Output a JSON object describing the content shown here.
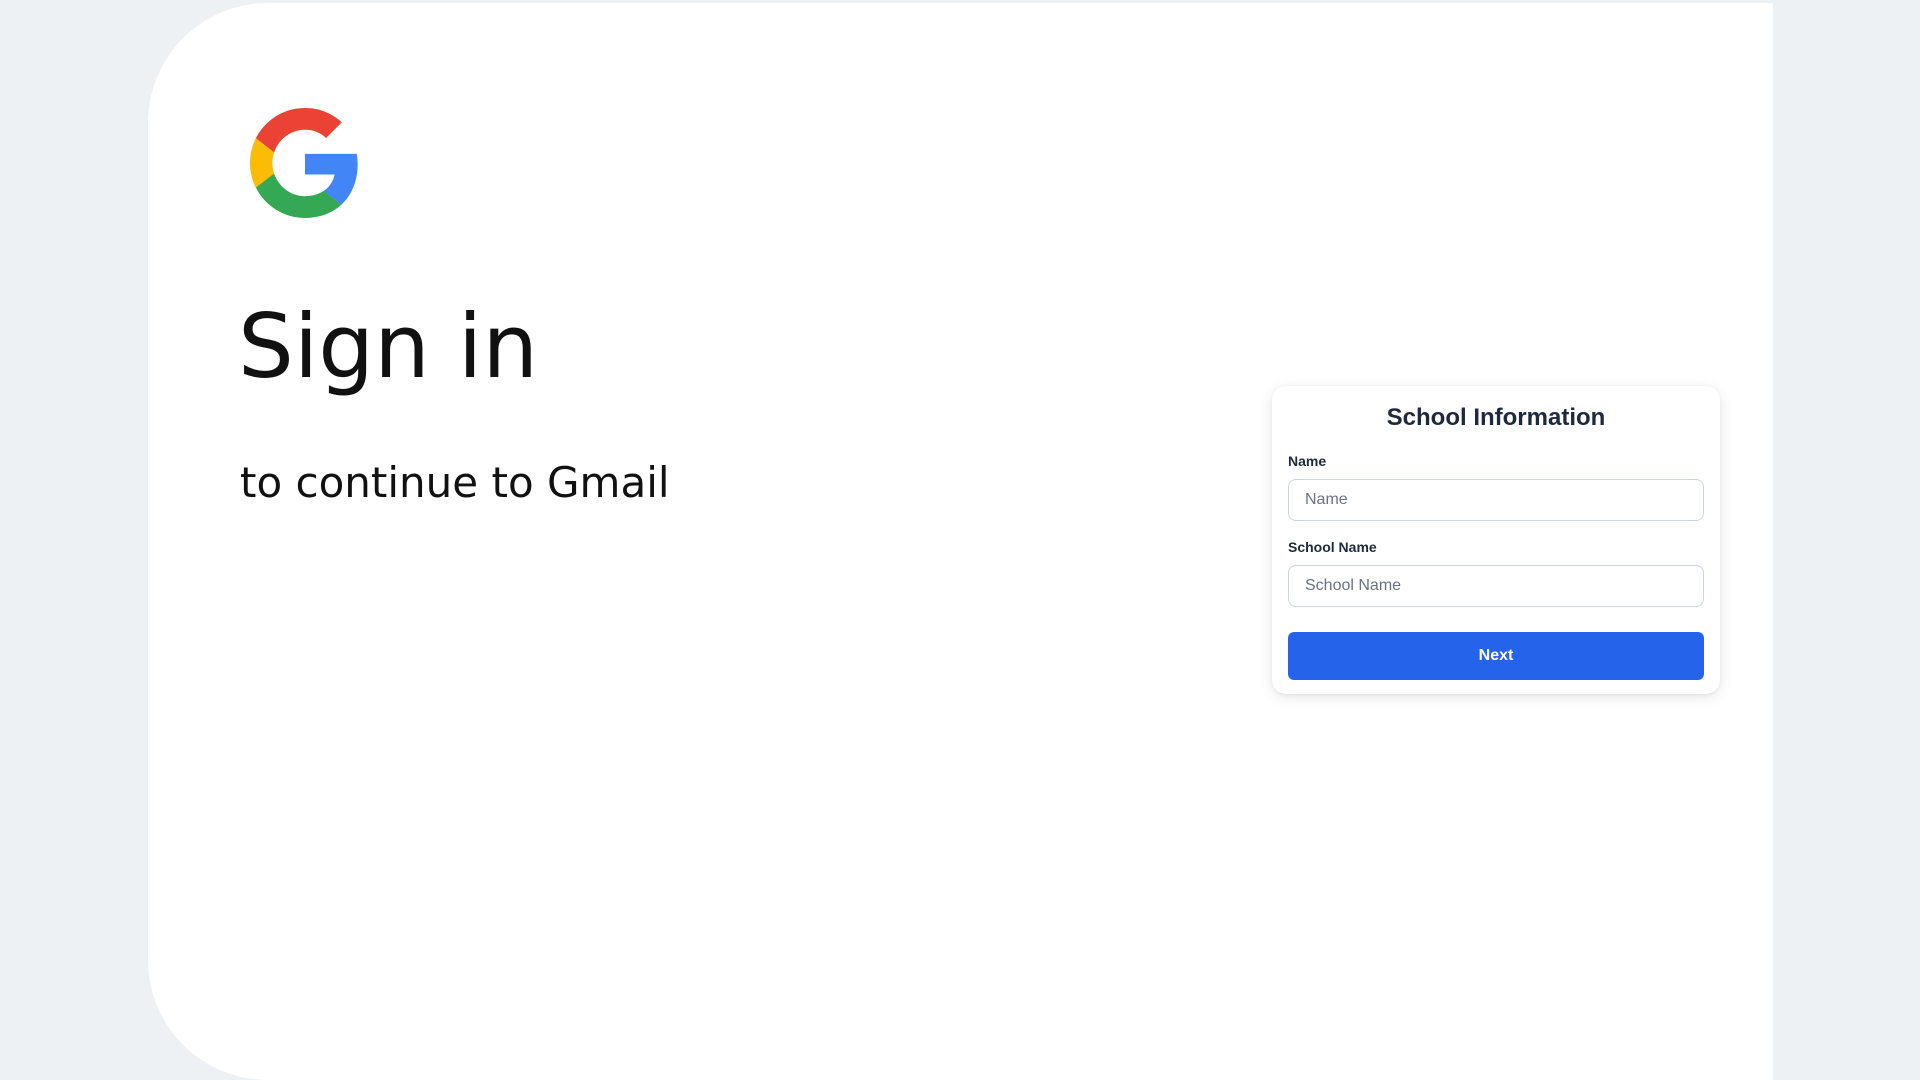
{
  "brand": {
    "logo_icon": "google-g-icon",
    "colors": {
      "red": "#EA4335",
      "yellow": "#FBBC05",
      "green": "#34A853",
      "blue": "#4285F4"
    }
  },
  "signin": {
    "title": "Sign in",
    "subtitle": "to continue to Gmail"
  },
  "form": {
    "title": "School Information",
    "fields": [
      {
        "label": "Name",
        "placeholder": "Name",
        "value": ""
      },
      {
        "label": "School Name",
        "placeholder": "School Name",
        "value": ""
      }
    ],
    "submit_label": "Next"
  },
  "theme": {
    "page_background": "#eef1f4",
    "panel_background": "#ffffff",
    "button_color": "#2563eb",
    "text_color": "#1e293b"
  }
}
